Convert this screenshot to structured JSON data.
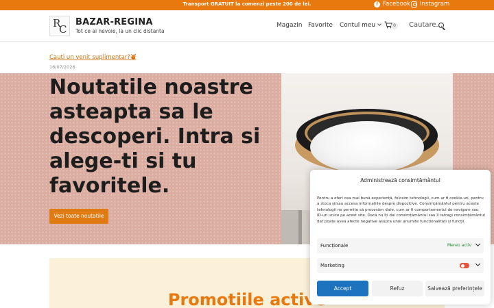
{
  "topbar": {
    "promo": "Transport GRATUIT la comenzi peste 200 de lei.",
    "facebook": "Facebook",
    "instagram": "Instagram",
    "bg_color": "#e8790e"
  },
  "header": {
    "logo_letters": [
      "R",
      "C"
    ],
    "brand": "BAZAR-REGINA",
    "tagline": "Tot ce ai nevoie, la un clic distanta",
    "nav": [
      "Magazin",
      "Favorite",
      "Contul meu"
    ],
    "cart_count": "0",
    "search_label": "Cautare..."
  },
  "intro": {
    "link": "Cauti un venit suplimentar?⛇",
    "date": "16/07/2026"
  },
  "hero": {
    "title": "Noutatile noastre asteapta sa le descoperi. Intra si alege-ti si tu favoritele.",
    "button": "Vezi toate noutatile",
    "button_color": "#e07b13"
  },
  "promo_section": {
    "title": "Promotiile active"
  },
  "consent": {
    "title": "Administrează consimțământul",
    "text": "Pentru a oferi cea mai bună experiență, folosim tehnologii, cum ar fi cookie-uri, pentru a stoca și/sau accesa informațiile despre dispozitive. Consimțământul pentru aceste tehnologii ne permite să procesăm date, cum ar fi comportamentul de navigare sau ID-uri unice pe acest site. Dacă nu îți dai consimțământul sau îl retragi consimțământul dat poate avea afecte negative asupra unor anumite funcționalități și funcții.",
    "rows": [
      {
        "label": "Funcționale",
        "status": "Mereu activ"
      },
      {
        "label": "Marketing",
        "status": ""
      }
    ],
    "accept": "Accept",
    "refuse": "Refuz",
    "save": "Salvează preferințele"
  }
}
